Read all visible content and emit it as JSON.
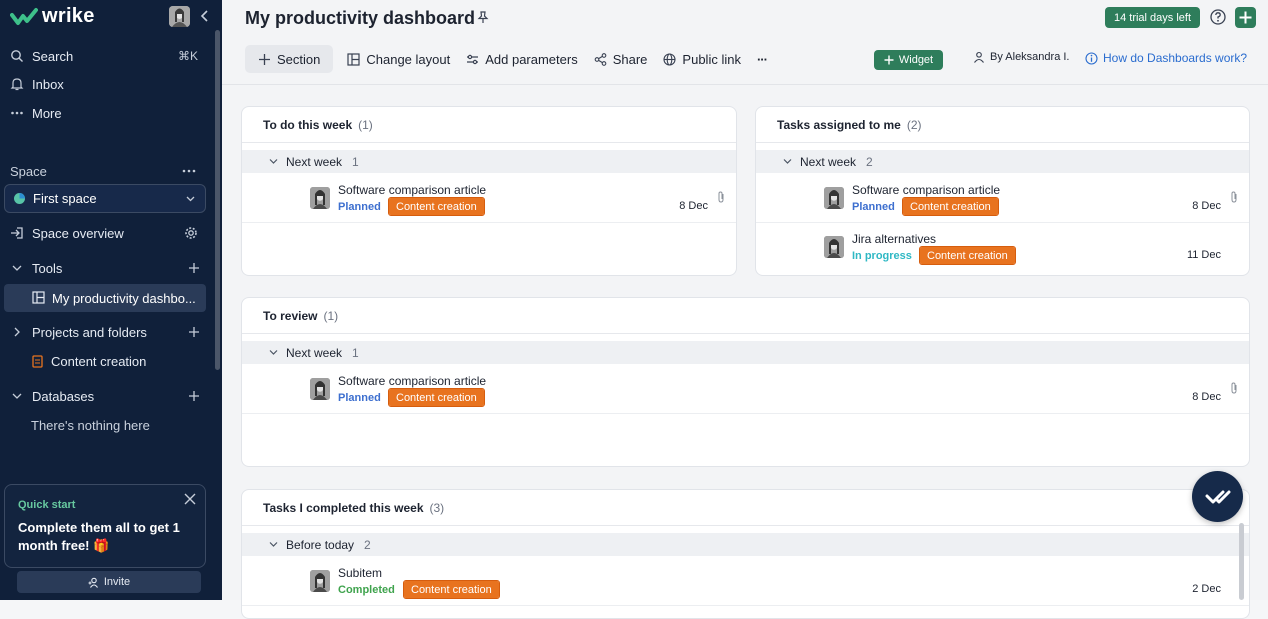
{
  "colors": {
    "sidebar_bg": "#10203a",
    "accent_green": "#2e7d5b",
    "tag_orange": "#e8731f",
    "status_planned": "#3d6fcf",
    "status_in_progress": "#2fb8c4",
    "status_completed": "#3fa34d",
    "link_blue": "#2a6ccf"
  },
  "sidebar": {
    "logo": "wrike",
    "nav": [
      {
        "label": "Search",
        "icon": "search-icon",
        "shortcut": "⌘K"
      },
      {
        "label": "Inbox",
        "icon": "bell-icon"
      },
      {
        "label": "More",
        "icon": "more-dots-icon"
      }
    ],
    "space_label": "Space",
    "space_selected": "First space",
    "space_overview": "Space overview",
    "tools_label": "Tools",
    "active_item": "My productivity dashbo...",
    "projects_label": "Projects and folders",
    "project_item": "Content creation",
    "databases_label": "Databases",
    "databases_empty": "There's nothing here",
    "quick_start": {
      "title": "Quick start",
      "line1": "Complete them all to get 1",
      "line2": "month free! 🎁"
    },
    "invite": "Invite"
  },
  "header": {
    "title": "My productivity dashboard",
    "trial": "14 trial days left",
    "toolbar": {
      "section": "Section",
      "change_layout": "Change layout",
      "add_parameters": "Add parameters",
      "share": "Share",
      "public_link": "Public link",
      "more": "···"
    },
    "widget": "Widget",
    "by": "By Aleksandra I.",
    "how": "How do Dashboards work?"
  },
  "widgets": [
    {
      "title": "To do this week",
      "count": "(1)",
      "group": "Next week",
      "group_count": "1",
      "tasks": [
        {
          "name": "Software comparison article",
          "status": "Planned",
          "tag": "Content creation",
          "date": "8 Dec",
          "attachment": true
        }
      ]
    },
    {
      "title": "Tasks assigned to me",
      "count": "(2)",
      "group": "Next week",
      "group_count": "2",
      "tasks": [
        {
          "name": "Software comparison article",
          "status": "Planned",
          "tag": "Content creation",
          "date": "8 Dec",
          "attachment": true
        },
        {
          "name": "Jira alternatives",
          "status": "In progress",
          "tag": "Content creation",
          "date": "11 Dec",
          "attachment": false
        }
      ]
    },
    {
      "title": "To review",
      "count": "(1)",
      "group": "Next week",
      "group_count": "1",
      "tasks": [
        {
          "name": "Software comparison article",
          "status": "Planned",
          "tag": "Content creation",
          "date": "8 Dec",
          "attachment": true
        }
      ]
    },
    {
      "title": "Tasks I completed this week",
      "count": "(3)",
      "group": "Before today",
      "group_count": "2",
      "tasks": [
        {
          "name": "Subitem",
          "status": "Completed",
          "tag": "Content creation",
          "date": "2 Dec",
          "attachment": false
        }
      ]
    }
  ]
}
